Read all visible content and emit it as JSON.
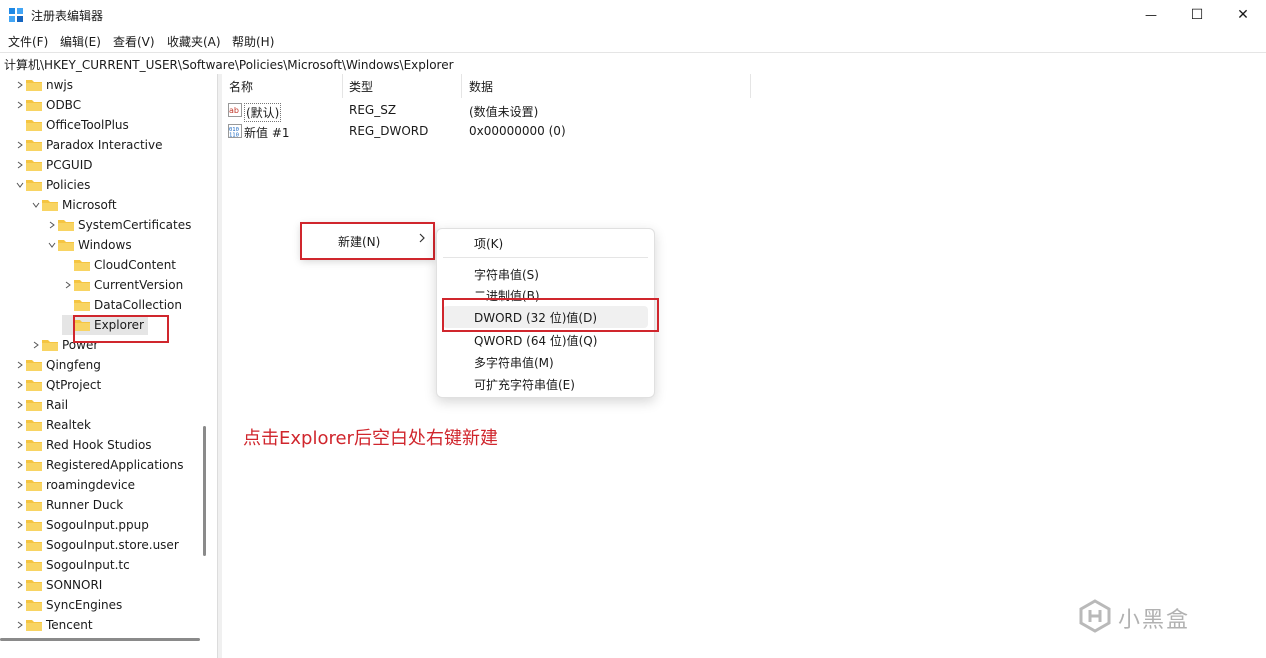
{
  "window": {
    "title": "注册表编辑器",
    "minimize_glyph": "—",
    "maximize_glyph": "☐",
    "close_glyph": "✕"
  },
  "menu": [
    "文件(F)",
    "编辑(E)",
    "查看(V)",
    "收藏夹(A)",
    "帮助(H)"
  ],
  "address": "计算机\\HKEY_CURRENT_USER\\Software\\Policies\\Microsoft\\Windows\\Explorer",
  "tree": [
    {
      "label": "nwjs"
    },
    {
      "label": "ODBC"
    },
    {
      "label": "OfficeToolPlus"
    },
    {
      "label": "Paradox Interactive"
    },
    {
      "label": "PCGUID"
    },
    {
      "label": "Policies"
    },
    {
      "label": "Microsoft"
    },
    {
      "label": "SystemCertificates"
    },
    {
      "label": "Windows"
    },
    {
      "label": "CloudContent"
    },
    {
      "label": "CurrentVersion"
    },
    {
      "label": "DataCollection"
    },
    {
      "label": "Explorer"
    },
    {
      "label": "Power"
    },
    {
      "label": "Qingfeng"
    },
    {
      "label": "QtProject"
    },
    {
      "label": "Rail"
    },
    {
      "label": "Realtek"
    },
    {
      "label": "Red Hook Studios"
    },
    {
      "label": "RegisteredApplications"
    },
    {
      "label": "roamingdevice"
    },
    {
      "label": "Runner Duck"
    },
    {
      "label": "SogouInput.ppup"
    },
    {
      "label": "SogouInput.store.user"
    },
    {
      "label": "SogouInput.tc"
    },
    {
      "label": "SONNORI"
    },
    {
      "label": "SyncEngines"
    },
    {
      "label": "Tencent"
    }
  ],
  "list": {
    "columns": [
      "名称",
      "类型",
      "数据"
    ],
    "rows": [
      {
        "name": "(默认)",
        "type": "REG_SZ",
        "data": "(数值未设置)",
        "icon": "string-value-icon"
      },
      {
        "name": "新值 #1",
        "type": "REG_DWORD",
        "data": "0x00000000 (0)",
        "icon": "binary-value-icon"
      }
    ]
  },
  "context_menu": {
    "parent_item": "新建(N)",
    "submenu": [
      "项(K)",
      "字符串值(S)",
      "二进制值(B)",
      "DWORD (32 位)值(D)",
      "QWORD (64 位)值(Q)",
      "多字符串值(M)",
      "可扩充字符串值(E)"
    ]
  },
  "annotation": "点击Explorer后空白处右键新建",
  "watermark": "小黑盒",
  "colors": {
    "highlight_red": "#d0262d",
    "folder_yellow": "#f5c542"
  }
}
